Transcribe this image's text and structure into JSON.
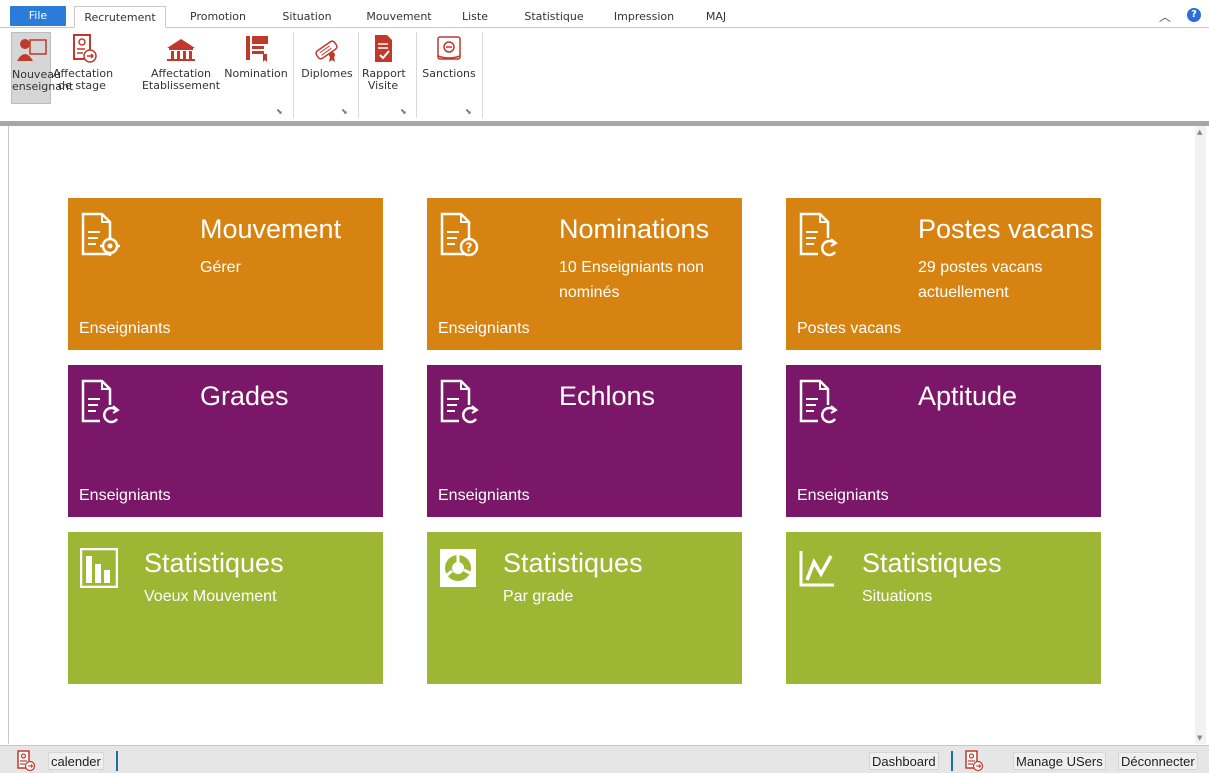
{
  "ribbon_tabs": {
    "file": "File",
    "items": [
      "Recrutement",
      "Promotion",
      "Situation",
      "Mouvement",
      "Liste",
      "Statistique",
      "Impression",
      "MAJ"
    ],
    "active": "Recrutement"
  },
  "ribbon_buttons": {
    "nouveau_enseignant": [
      "Nouveau",
      "enseignant"
    ],
    "affectation_stage": [
      "Affectation",
      "de stage"
    ],
    "affectation_etablissement": [
      "Affectation",
      "Etablissement"
    ],
    "nomination": [
      "Nomination"
    ],
    "diplomes": [
      "Diplomes"
    ],
    "rapport_visite": [
      "Rapport",
      "Visite"
    ],
    "sanctions": [
      "Sanctions"
    ]
  },
  "tiles": [
    {
      "title": "Mouvement",
      "subtitle": "Gérer",
      "footer": "Enseigniants",
      "color": "#d68311",
      "icon": "document-gear-icon"
    },
    {
      "title": "Nominations",
      "subtitle": "10 Enseigniants non nominés",
      "footer": "Enseigniants",
      "color": "#d68311",
      "icon": "document-question-icon"
    },
    {
      "title": "Postes vacans",
      "subtitle": "29 postes vacans actuellement",
      "footer": "Postes vacans",
      "color": "#d68311",
      "icon": "document-refresh-icon"
    },
    {
      "title": "Grades",
      "subtitle": "",
      "footer": "Enseigniants",
      "color": "#7b1768",
      "icon": "document-refresh-icon"
    },
    {
      "title": "Echlons",
      "subtitle": "",
      "footer": "Enseigniants",
      "color": "#7b1768",
      "icon": "document-refresh-icon"
    },
    {
      "title": "Aptitude",
      "subtitle": "",
      "footer": "Enseigniants",
      "color": "#7b1768",
      "icon": "document-refresh-icon"
    },
    {
      "title": "Statistiques",
      "subtitle": "Voeux Mouvement",
      "footer": "",
      "color": "#9db634",
      "icon": "bar-chart-icon"
    },
    {
      "title": "Statistiques",
      "subtitle": "Par grade",
      "footer": "",
      "color": "#9db634",
      "icon": "pie-chart-icon"
    },
    {
      "title": "Statistiques",
      "subtitle": "Situations",
      "footer": "",
      "color": "#9db634",
      "icon": "line-chart-icon"
    }
  ],
  "statusbar": {
    "calender": "calender",
    "dashboard": "Dashboard",
    "manage_users": "Manage USers",
    "deconnecter": "Déconnecter"
  },
  "colors": {
    "ribbon_icon": "#c0392b",
    "file_tab": "#2b7bd8",
    "orange": "#d68311",
    "purple": "#7b1768",
    "green": "#9db634"
  }
}
